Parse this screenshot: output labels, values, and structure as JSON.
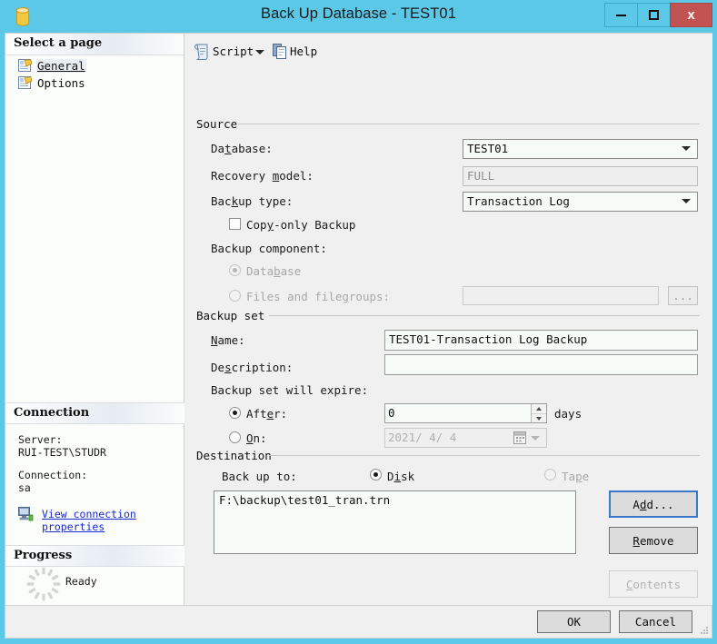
{
  "window": {
    "title": "Back Up Database - TEST01",
    "icon": "database-cylinder-icon",
    "minimize_label": "–",
    "maximize_label": "□",
    "close_label": "x",
    "titlebar_color": "#5bc8e8",
    "close_color": "#c15353"
  },
  "sidebar": {
    "header": "Select a page",
    "items": [
      {
        "label": "General",
        "icon": "page-icon",
        "selected": true
      },
      {
        "label": "Options",
        "icon": "page-icon",
        "selected": false
      }
    ],
    "connection": {
      "header": "Connection",
      "server_label": "Server:",
      "server_value": "RUI-TEST\\STUDR",
      "connection_label": "Connection:",
      "connection_value": "sa",
      "link_label": "View connection properties",
      "link_icon": "server-connection-icon",
      "link_color": "#1b28d0"
    },
    "progress": {
      "header": "Progress",
      "status": "Ready",
      "icon": "spinner-icon"
    }
  },
  "toolbar": {
    "script_label": "Script",
    "script_icon": "script-icon",
    "script_dropdown_icon": "chevron-down-icon",
    "help_label": "Help",
    "help_icon": "help-page-icon"
  },
  "source": {
    "group_label": "Source",
    "database_label": "Database:",
    "database_value": "TEST01",
    "recovery_model_label": "Recovery model:",
    "recovery_model_value": "FULL",
    "backup_type_label": "Backup type:",
    "backup_type_value": "Transaction Log",
    "copy_only_label": "Copy-only Backup",
    "copy_only_checked": false,
    "backup_component_label": "Backup component:",
    "component_database_label": "Database",
    "component_database_selected": true,
    "component_files_label": "Files and filegroups:",
    "component_files_selected": false,
    "files_value": "",
    "browse_label": "..."
  },
  "backup_set": {
    "group_label": "Backup set",
    "name_label": "Name:",
    "name_value": "TEST01-Transaction Log  Backup",
    "description_label": "Description:",
    "description_value": "",
    "expire_label": "Backup set will expire:",
    "after_label": "After:",
    "after_selected": true,
    "after_value": "0",
    "days_label": "days",
    "on_label": "On:",
    "on_selected": false,
    "on_value": "2021/ 4/ 4",
    "calendar_icon": "calendar-icon"
  },
  "destination": {
    "group_label": "Destination",
    "back_up_to_label": "Back up to:",
    "disk_label": "Disk",
    "disk_selected": true,
    "tape_label": "Tape",
    "tape_selected": false,
    "paths": [
      "F:\\backup\\test01_tran.trn"
    ],
    "add_label": "Add...",
    "remove_label": "Remove",
    "contents_label": "Contents"
  },
  "footer": {
    "ok_label": "OK",
    "cancel_label": "Cancel"
  }
}
